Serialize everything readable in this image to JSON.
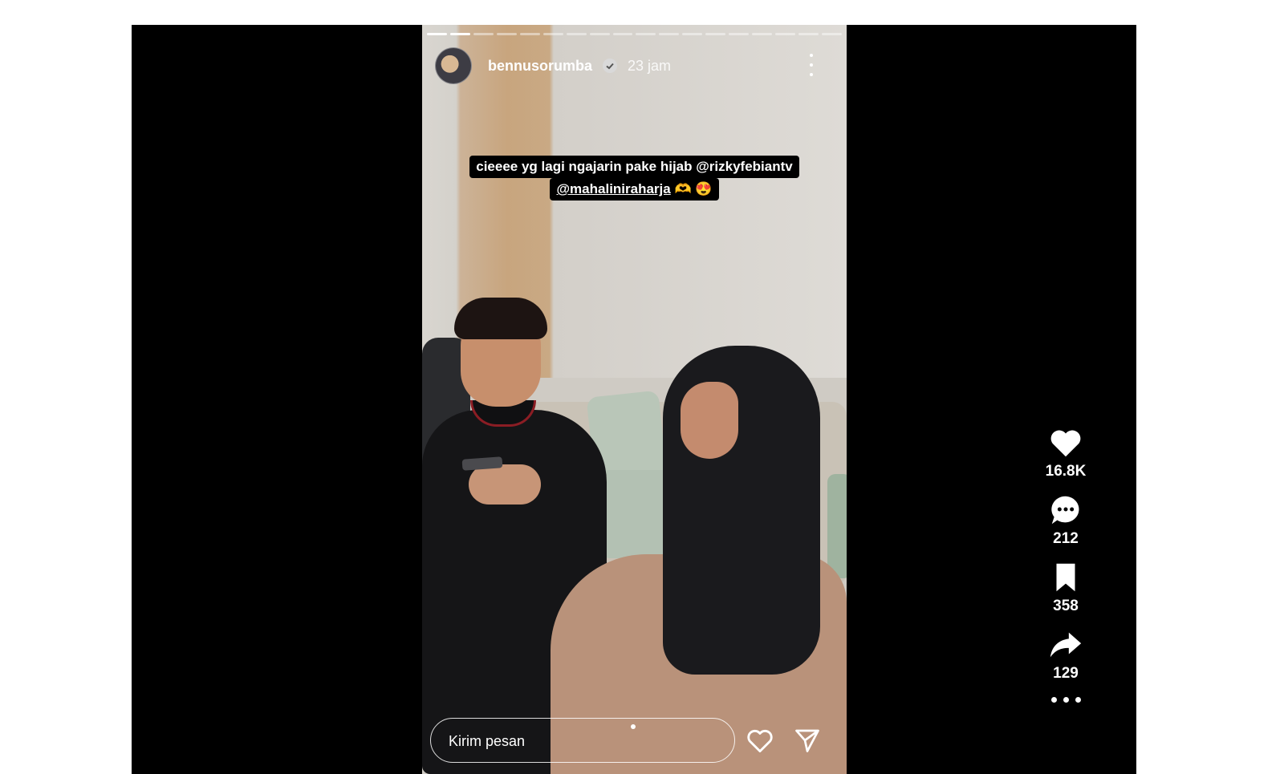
{
  "story": {
    "username": "bennusorumba",
    "time": "23 jam",
    "caption_line1": "cieeee yg lagi ngajarin pake hijab @rizkyfebiantv",
    "caption_line2_mention": "@mahaliniraharja",
    "caption_line2_emoji": " 🫶 😍",
    "progress_segments": 18,
    "progress_current": 2,
    "message_placeholder": "Kirim pesan"
  },
  "actions": {
    "likes": "16.8K",
    "comments": "212",
    "saves": "358",
    "shares": "129"
  },
  "colors": {
    "background": "#000000",
    "text": "#ffffff"
  }
}
